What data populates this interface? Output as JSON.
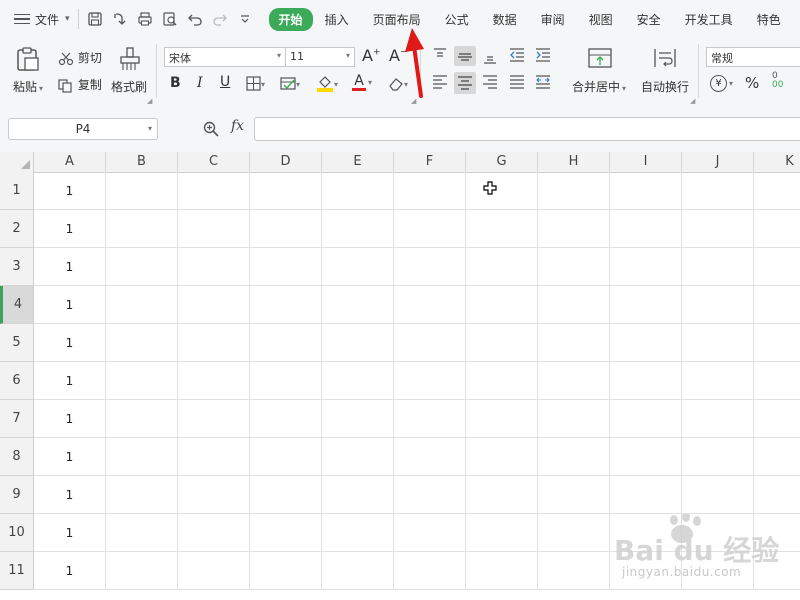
{
  "menu": {
    "file_label": "文件",
    "quick_access": [
      "save-icon",
      "export-icon",
      "print-icon",
      "print-preview-icon",
      "undo-icon",
      "redo-icon",
      "more-icon"
    ],
    "tabs": [
      {
        "label": "开始",
        "active": true
      },
      {
        "label": "插入"
      },
      {
        "label": "页面布局"
      },
      {
        "label": "公式"
      },
      {
        "label": "数据"
      },
      {
        "label": "审阅"
      },
      {
        "label": "视图"
      },
      {
        "label": "安全"
      },
      {
        "label": "开发工具"
      },
      {
        "label": "特色"
      }
    ],
    "active_color": "#3bab5a"
  },
  "ribbon": {
    "paste_label": "粘贴",
    "cut_label": "剪切",
    "copy_label": "复制",
    "format_painter_label": "格式刷",
    "font_name": "宋体",
    "font_size": "11",
    "bold": "B",
    "italic": "I",
    "underline": "U",
    "font_color_letter": "A",
    "grow_font": "A",
    "shrink_font": "A",
    "merge_center_label": "合并居中",
    "wrap_text_label": "自动换行",
    "number_format": "常规",
    "currency_symbol": "¥",
    "percent_symbol": "%",
    "font_color": "#e02020",
    "fill_color": "#ffd800"
  },
  "formula_bar": {
    "cell_ref": "P4",
    "fx_label": "fx",
    "content": ""
  },
  "sheet": {
    "columns": [
      "A",
      "B",
      "C",
      "D",
      "E",
      "F",
      "G",
      "H",
      "I",
      "J",
      "K"
    ],
    "rows": [
      {
        "num": "1",
        "a": "1"
      },
      {
        "num": "2",
        "a": "1"
      },
      {
        "num": "3",
        "a": "1"
      },
      {
        "num": "4",
        "a": "1",
        "selected": true
      },
      {
        "num": "5",
        "a": "1"
      },
      {
        "num": "6",
        "a": "1"
      },
      {
        "num": "7",
        "a": "1"
      },
      {
        "num": "8",
        "a": "1"
      },
      {
        "num": "9",
        "a": "1"
      },
      {
        "num": "10",
        "a": "1"
      },
      {
        "num": "11",
        "a": "1"
      }
    ],
    "selection_color": "#3ba35a"
  },
  "watermark": {
    "brand": "Bai du 经验",
    "url": "jingyan.baidu.com"
  },
  "annotation_arrow_color": "#e01818"
}
